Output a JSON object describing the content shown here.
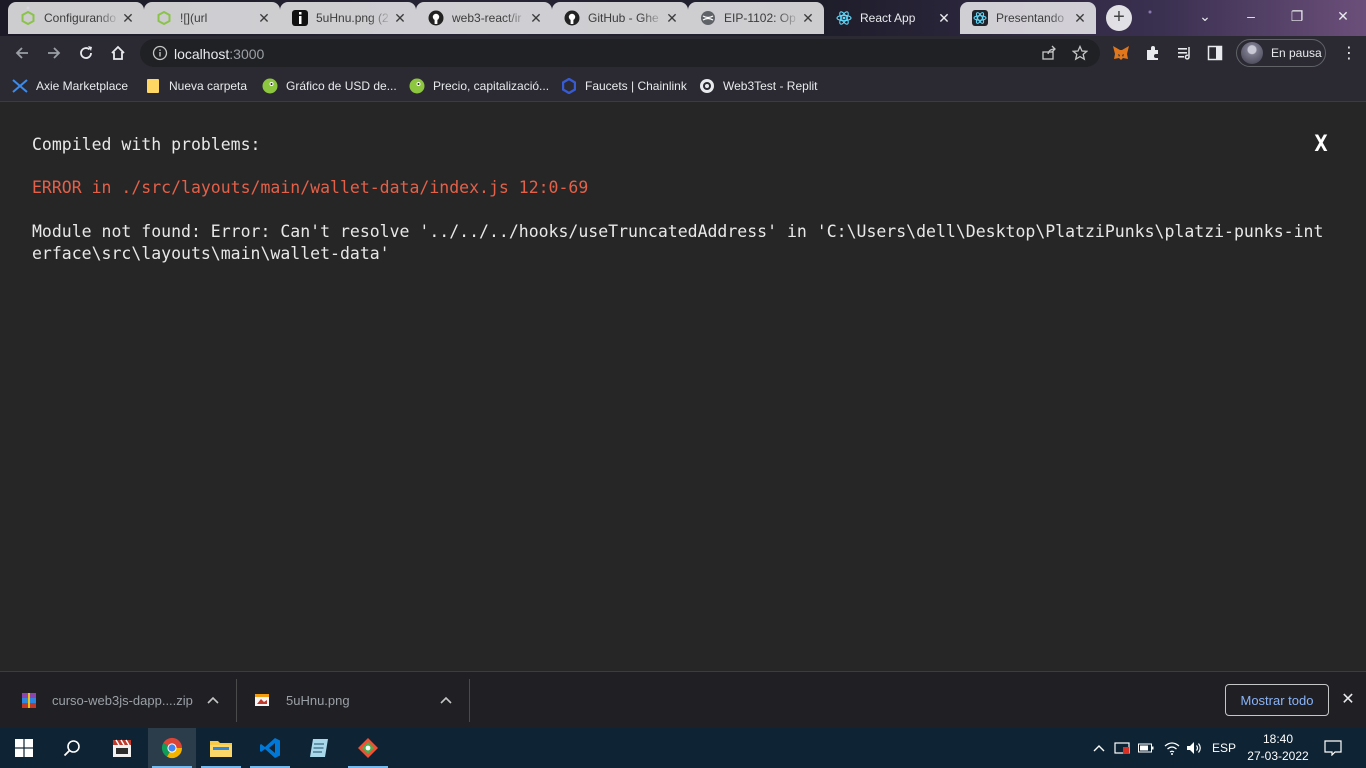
{
  "tabs": [
    {
      "title": "Configurando",
      "icon": "green-hex-icon"
    },
    {
      "title": "![](url",
      "icon": "green-hex-icon"
    },
    {
      "title": "5uHnu.png (2",
      "icon": "info-square-icon"
    },
    {
      "title": "web3-react/ir",
      "icon": "github-icon"
    },
    {
      "title": "GitHub - Ghe",
      "icon": "github-icon"
    },
    {
      "title": "EIP-1102: Op",
      "icon": "globe-icon"
    },
    {
      "title": "React App",
      "icon": "react-icon",
      "active": true
    },
    {
      "title": "Presentando",
      "icon": "react-icon"
    }
  ],
  "toolbar": {
    "url_host": "localhost",
    "url_port": ":3000",
    "profile_label": "En pausa"
  },
  "bookmarks": [
    {
      "label": "Axie Marketplace",
      "icon": "axie-icon"
    },
    {
      "label": "Nueva carpeta",
      "icon": "folder-icon"
    },
    {
      "label": "Gráfico de USD de...",
      "icon": "coingecko-icon"
    },
    {
      "label": "Precio, capitalizació...",
      "icon": "coingecko-icon"
    },
    {
      "label": "Faucets | Chainlink",
      "icon": "chainlink-icon"
    },
    {
      "label": "Web3Test - Replit",
      "icon": "replit-icon"
    }
  ],
  "overlay": {
    "title": "Compiled with problems:",
    "close_label": "X",
    "error_heading": "ERROR in ./src/layouts/main/wallet-data/index.js 12:0-69",
    "error_message": "Module not found: Error: Can't resolve '../../../hooks/useTruncatedAddress' in 'C:\\Users\\dell\\Desktop\\PlatziPunks\\platzi-punks-interface\\src\\layouts\\main\\wallet-data'"
  },
  "downloads": [
    {
      "name": "curso-web3js-dapp....zip",
      "icon": "winrar-icon"
    },
    {
      "name": "5uHnu.png",
      "icon": "image-file-icon"
    }
  ],
  "shelf": {
    "show_all": "Mostrar todo"
  },
  "taskbar": {
    "language": "ESP",
    "time": "18:40",
    "date": "27-03-2022"
  },
  "colors": {
    "overlay_bg": "#262626",
    "error_red": "#e36049",
    "link_blue": "#8ab4f8",
    "taskbar_bg": "#0e2333"
  }
}
